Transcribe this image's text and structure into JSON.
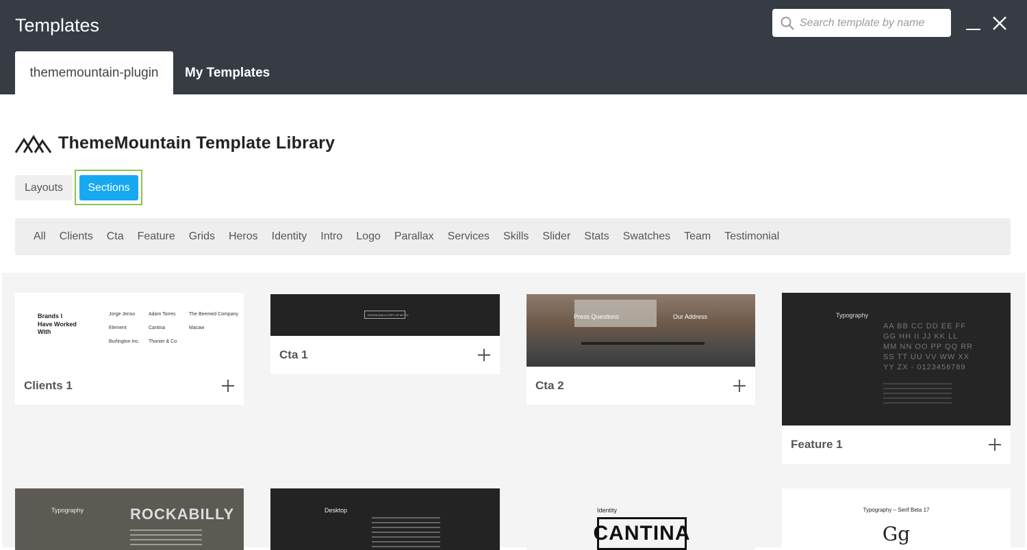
{
  "header": {
    "title": "Templates",
    "search_placeholder": "Search template by name",
    "tabs": [
      {
        "label": "thememountain-plugin",
        "active": true
      },
      {
        "label": "My Templates",
        "active": false
      }
    ]
  },
  "library": {
    "title": "ThemeMountain Template Library",
    "type_buttons": [
      {
        "label": "Layouts",
        "active": false
      },
      {
        "label": "Sections",
        "active": true
      }
    ],
    "categories": [
      "All",
      "Clients",
      "Cta",
      "Feature",
      "Grids",
      "Heros",
      "Identity",
      "Intro",
      "Logo",
      "Parallax",
      "Services",
      "Skills",
      "Slider",
      "Stats",
      "Swatches",
      "Team",
      "Testimonial"
    ]
  },
  "cards": [
    {
      "name": "Clients 1"
    },
    {
      "name": "Cta 1"
    },
    {
      "name": "Cta 2"
    },
    {
      "name": "Feature 1"
    }
  ],
  "thumbs": {
    "clients": {
      "heading": "Brands I Have Worked With",
      "names": [
        "Jorge Jenso",
        "Adam Torres",
        "The Beemed Company",
        "Element",
        "Cantina",
        "Macaw",
        "Burlington Inc.",
        "Thonier & Co"
      ]
    },
    "cta1": {
      "button": "DOWNLOAD A COPY OF MY CV"
    },
    "cta2": {
      "left": "Press Questions",
      "right": "Our Address"
    },
    "feature1": {
      "heading": "Typography",
      "lines": [
        "AA BB CC DD EE FF",
        "GG HH II JJ KK LL",
        "MM NN OO PP QQ RR",
        "SS TT UU VV WW XX",
        "YY ZX - 0123456789"
      ]
    },
    "row2": [
      {
        "heading": "Typography",
        "brand": "ROCKABILLY"
      },
      {
        "heading": "Desktop"
      },
      {
        "heading": "Identity",
        "brand": "CANTINA"
      },
      {
        "heading": "Typography – Serif Beta 17",
        "glyph": "Gg"
      }
    ]
  },
  "colors": {
    "header_bg": "#363b44",
    "accent": "#17a9f0",
    "focus": "#8bc34a"
  }
}
